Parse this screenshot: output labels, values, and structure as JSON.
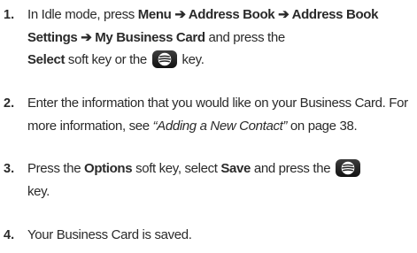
{
  "steps": [
    {
      "num": "1.",
      "t1": "In Idle mode, press ",
      "menu": "Menu",
      "arrow1": " ➔ ",
      "address_book": "Address Book",
      "arrow2": " ➔ ",
      "address_book_settings": "Address Book Settings",
      "arrow3": " ➔ ",
      "my_business_card": "My Business Card",
      "t2": " and press the",
      "select": "Select",
      "t3": " soft key or the ",
      "t4": " key."
    },
    {
      "num": "2.",
      "t1": "Enter the information that you would like on your Business Card. For more information, see ",
      "ref": "“Adding a New Contact”",
      "t2": " on page 38."
    },
    {
      "num": "3.",
      "t1": " Press the ",
      "options": "Options",
      "t2": " soft key, select ",
      "save": "Save",
      "t3": " and press the ",
      "t4": "key."
    },
    {
      "num": "4.",
      "t1": "Your Business Card is saved."
    }
  ],
  "icons": {
    "key": "ok-key-icon"
  }
}
